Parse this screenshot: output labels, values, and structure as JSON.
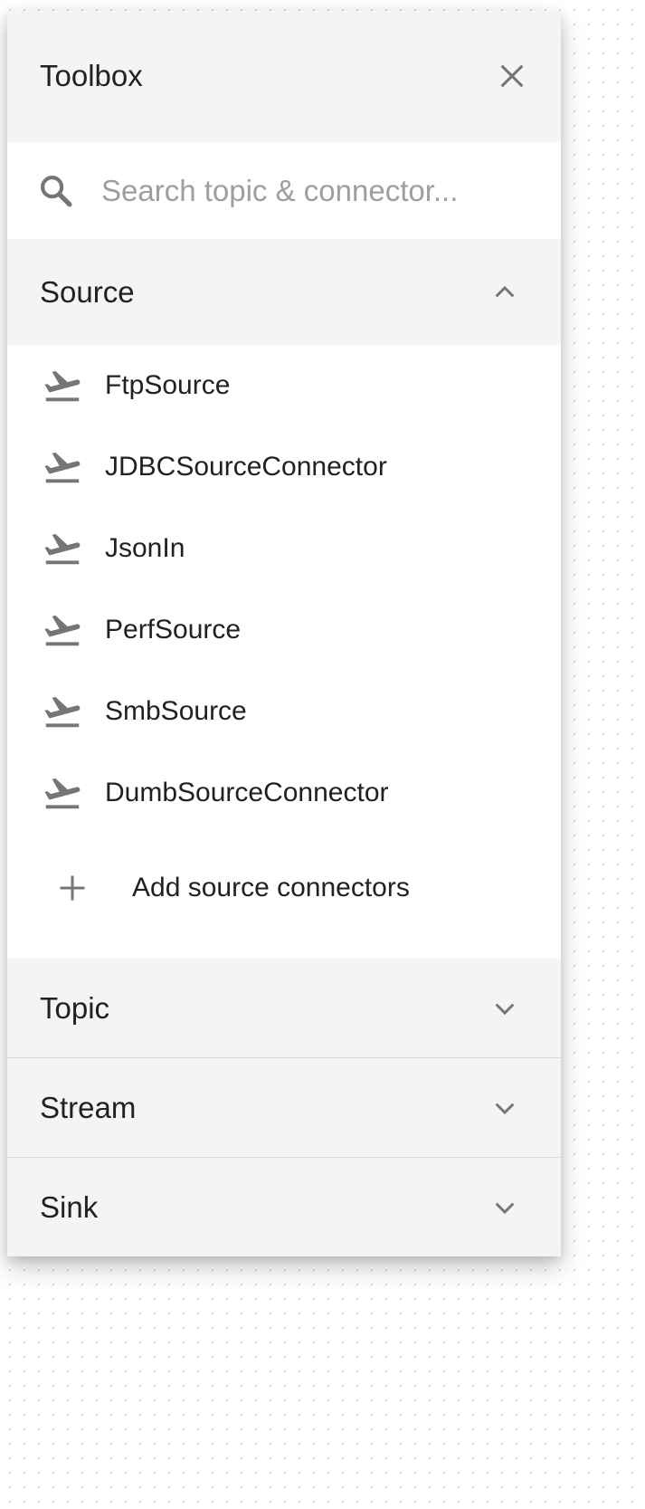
{
  "toolbox": {
    "title": "Toolbox",
    "close_icon": "close-icon"
  },
  "search": {
    "icon": "search-icon",
    "placeholder": "Search topic & connector...",
    "value": ""
  },
  "sections": {
    "source": {
      "label": "Source",
      "expanded": true,
      "items": [
        {
          "label": "FtpSource",
          "icon": "flight-takeoff-icon"
        },
        {
          "label": "JDBCSourceConnector",
          "icon": "flight-takeoff-icon"
        },
        {
          "label": "JsonIn",
          "icon": "flight-takeoff-icon"
        },
        {
          "label": "PerfSource",
          "icon": "flight-takeoff-icon"
        },
        {
          "label": "SmbSource",
          "icon": "flight-takeoff-icon"
        },
        {
          "label": "DumbSourceConnector",
          "icon": "flight-takeoff-icon"
        }
      ],
      "add_label": "Add source connectors"
    },
    "topic": {
      "label": "Topic",
      "expanded": false
    },
    "stream": {
      "label": "Stream",
      "expanded": false
    },
    "sink": {
      "label": "Sink",
      "expanded": false
    }
  },
  "colors": {
    "header_bg": "#f4f4f4",
    "icon": "#757575",
    "text": "#212121",
    "placeholder": "#9e9e9e"
  }
}
